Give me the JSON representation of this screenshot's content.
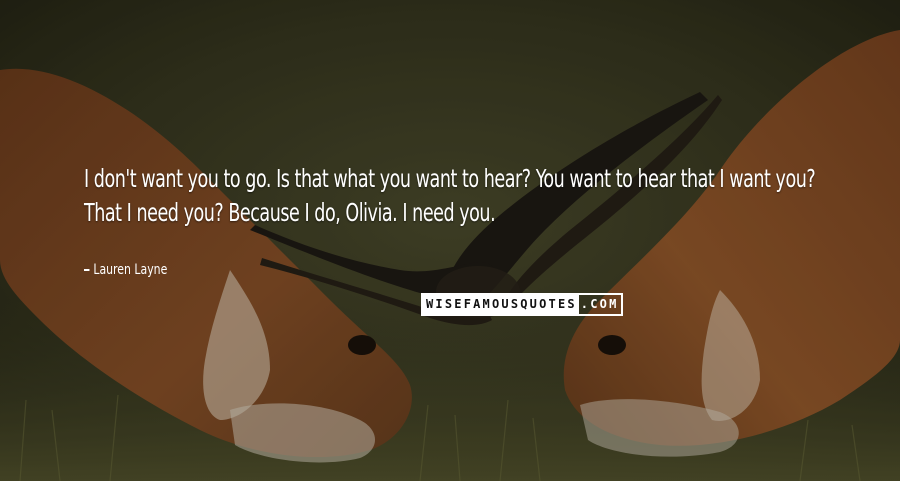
{
  "quote": {
    "text": "I don't want you to go. Is that what you want to hear? You want to hear that I want you? That I need you? Because I do, Olivia. I need you."
  },
  "author": {
    "name": "Lauren Layne"
  },
  "brand": {
    "part_a": "WISEFAMOUSQUOTES",
    "part_b": ".COM"
  },
  "colors": {
    "text": "#ffffff",
    "background": "#3a3a22"
  }
}
